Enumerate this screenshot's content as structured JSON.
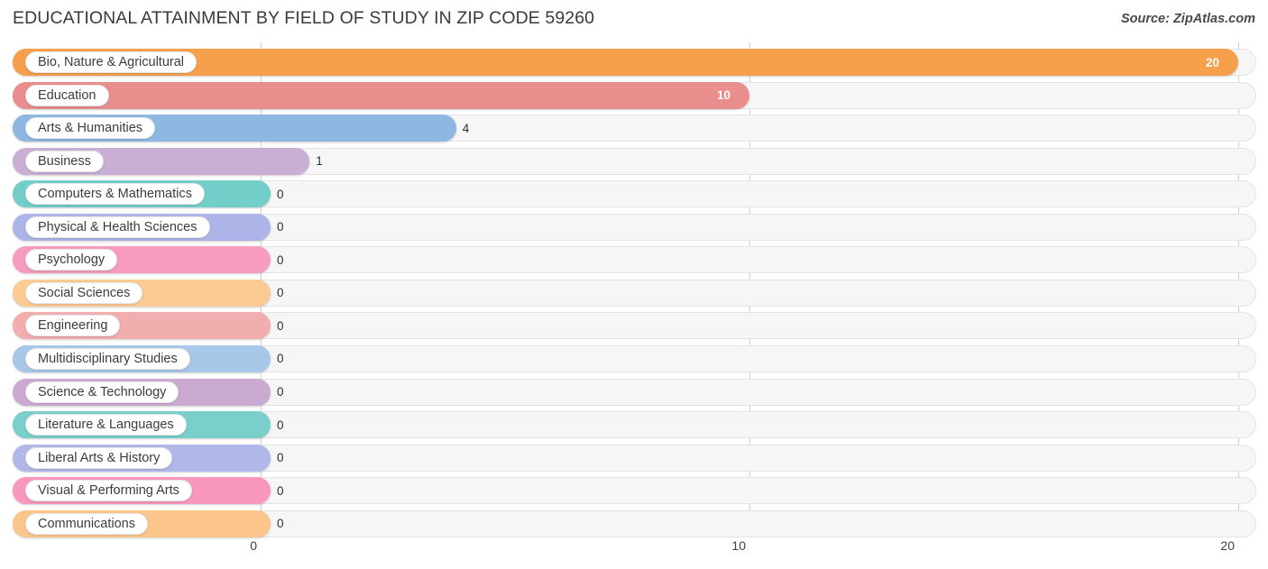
{
  "header": {
    "title": "EDUCATIONAL ATTAINMENT BY FIELD OF STUDY IN ZIP CODE 59260",
    "source": "Source: ZipAtlas.com"
  },
  "chart_data": {
    "type": "bar",
    "orientation": "horizontal",
    "title": "EDUCATIONAL ATTAINMENT BY FIELD OF STUDY IN ZIP CODE 59260",
    "xlabel": "",
    "ylabel": "",
    "xlim": [
      0,
      20
    ],
    "xticks": [
      "0",
      "10",
      "20"
    ],
    "grid": true,
    "legend": "none",
    "categories": [
      "Bio, Nature & Agricultural",
      "Education",
      "Arts & Humanities",
      "Business",
      "Computers & Mathematics",
      "Physical & Health Sciences",
      "Psychology",
      "Social Sciences",
      "Engineering",
      "Multidisciplinary Studies",
      "Science & Technology",
      "Literature & Languages",
      "Liberal Arts & History",
      "Visual & Performing Arts",
      "Communications"
    ],
    "values": [
      20,
      10,
      4,
      1,
      0,
      0,
      0,
      0,
      0,
      0,
      0,
      0,
      0,
      0,
      0
    ],
    "value_labels": [
      "20",
      "10",
      "4",
      "1",
      "0",
      "0",
      "0",
      "0",
      "0",
      "0",
      "0",
      "0",
      "0",
      "0",
      "0"
    ],
    "colors": [
      "#F6A04D",
      "#E98D8D",
      "#8EB8E2",
      "#C9AFD4",
      "#72CEC8",
      "#ADB4E7",
      "#F79BC0",
      "#FBCB93",
      "#F2AEAE",
      "#A8C8EA",
      "#CBAAD2",
      "#7ACFCB",
      "#B0B8E9",
      "#F997BD",
      "#FBC58C"
    ]
  }
}
